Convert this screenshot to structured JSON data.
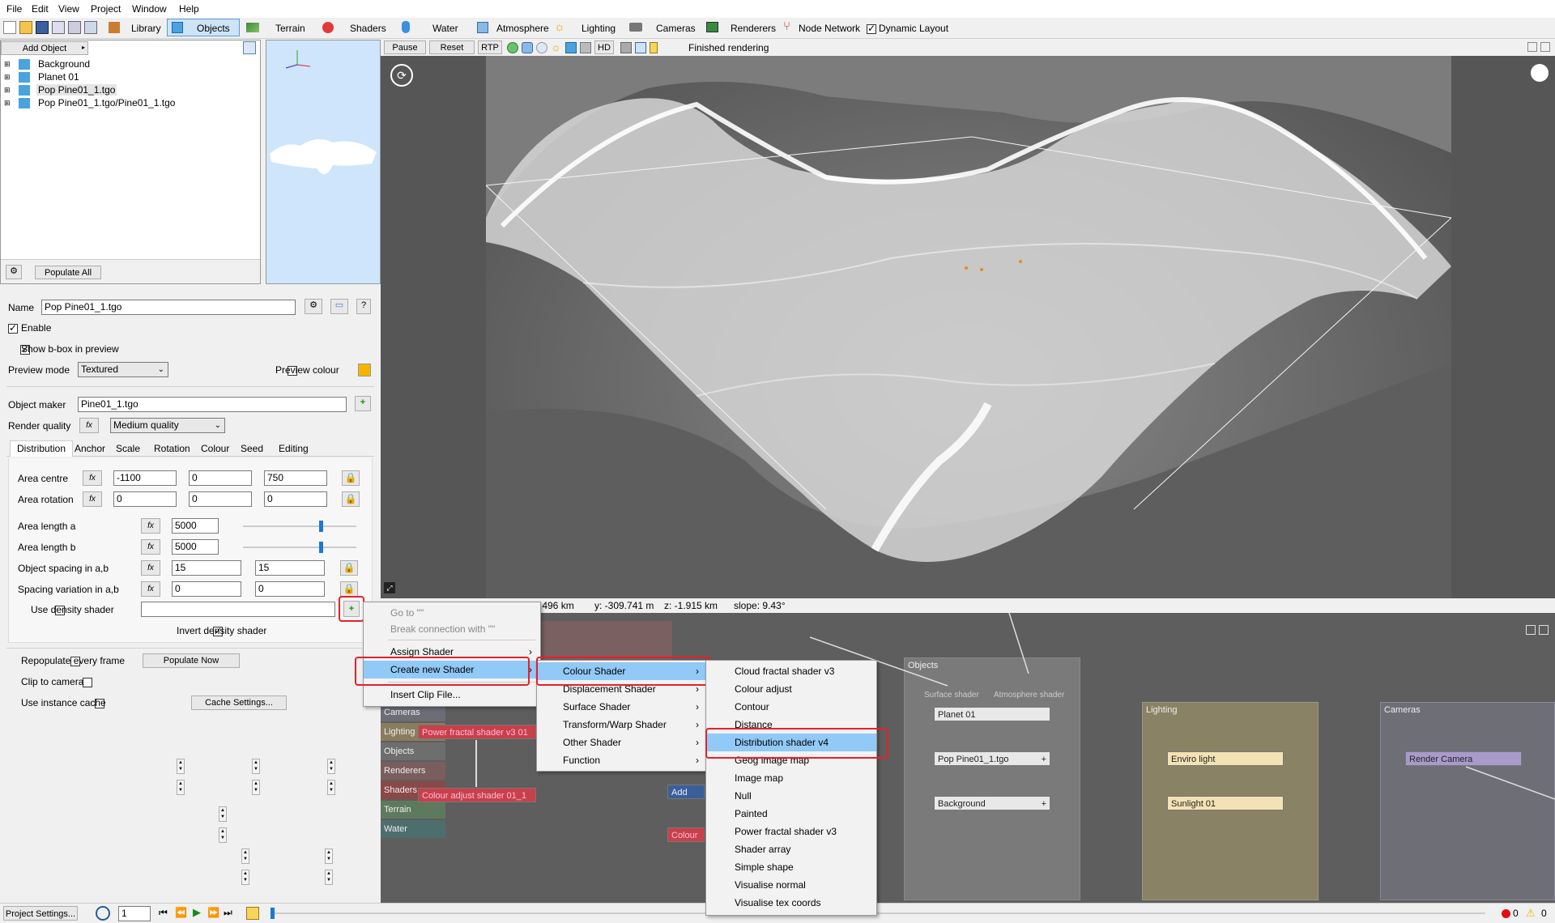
{
  "menubar": [
    "File",
    "Edit",
    "View",
    "Project",
    "Window",
    "Help"
  ],
  "toolbar_tabs": [
    "Library",
    "Objects",
    "Terrain",
    "Shaders",
    "Water",
    "Atmosphere",
    "Lighting",
    "Cameras",
    "Renderers",
    "Node Network"
  ],
  "dynamic_layout": "Dynamic Layout",
  "add_object": "Add Object",
  "tree": [
    "Background",
    "Planet 01",
    "Pop Pine01_1.tgo",
    "Pop Pine01_1.tgo/Pine01_1.tgo"
  ],
  "populate_all": "Populate All",
  "render_bar": {
    "pause": "Pause",
    "reset": "Reset",
    "rtp": "RTP",
    "hd": "HD",
    "status": "Finished rendering"
  },
  "props": {
    "name_label": "Name",
    "name_value": "Pop Pine01_1.tgo",
    "enable": "Enable",
    "show_bbox": "Show b-box in preview",
    "preview_mode_label": "Preview mode",
    "preview_mode": "Textured",
    "preview_colour": "Preview colour",
    "object_maker_label": "Object maker",
    "object_maker": "Pine01_1.tgo",
    "render_quality_label": "Render quality",
    "render_quality": "Medium quality",
    "tabs": [
      "Distribution",
      "Anchor",
      "Scale",
      "Rotation",
      "Colour",
      "Seed",
      "Editing"
    ],
    "area_centre": "Area centre",
    "area_centre_vals": [
      "-1100",
      "0",
      "750"
    ],
    "area_rotation": "Area rotation",
    "area_rotation_vals": [
      "0",
      "0",
      "0"
    ],
    "area_length_a": "Area length a",
    "area_length_a_val": "5000",
    "area_length_b": "Area length b",
    "area_length_b_val": "5000",
    "object_spacing": "Object spacing in a,b",
    "object_spacing_vals": [
      "15",
      "15"
    ],
    "spacing_variation": "Spacing variation in a,b",
    "spacing_variation_vals": [
      "0",
      "0"
    ],
    "use_density": "Use density shader",
    "invert_density": "Invert density shader",
    "repopulate": "Repopulate every frame",
    "populate_now": "Populate Now",
    "clip_camera": "Clip to camera",
    "use_instance_cache": "Use instance cache",
    "cache_settings": "Cache Settings..."
  },
  "status_coords": {
    "x": ".496 km",
    "y": "y: -309.741 m",
    "z": "z: -1.915 km",
    "slope": "slope: 9.43°"
  },
  "context_menu": [
    "Go to \"\"",
    "Break connection with \"\"",
    "Assign Shader",
    "Create new Shader",
    "Insert Clip File..."
  ],
  "submenu1": [
    "Colour Shader",
    "Displacement Shader",
    "Surface Shader",
    "Transform/Warp Shader",
    "Other Shader",
    "Function"
  ],
  "submenu2": [
    "Cloud fractal shader v3",
    "Colour adjust",
    "Contour",
    "Distance",
    "Distribution shader v4",
    "Geog image map",
    "Image map",
    "Null",
    "Painted",
    "Power fractal shader v3",
    "Shader array",
    "Simple shape",
    "Visualise normal",
    "Visualise tex coords"
  ],
  "node_sidebar": [
    "Cameras",
    "Lighting",
    "Objects",
    "Renderers",
    "Shaders",
    "Terrain",
    "Water"
  ],
  "nodes": {
    "power_fractal": "Power fractal shader v3 01",
    "colour_adjust": "Colour adjust shader 01_1",
    "add_colour": "Add colo",
    "colour_a": "Colour a",
    "objects_group": "Objects",
    "surface_shader": "Surface shader",
    "atmosphere_shader": "Atmosphere shader",
    "planet": "Planet 01",
    "pop_pine": "Pop Pine01_1.tgo",
    "background": "Background",
    "lighting_group": "Lighting",
    "enviro_light": "Enviro light",
    "sunlight": "Sunlight 01",
    "cameras_group": "Cameras",
    "render_camera": "Render Camera"
  },
  "bottom": {
    "project_settings": "Project Settings...",
    "frame": "1",
    "errors": "0",
    "warnings": "0"
  }
}
